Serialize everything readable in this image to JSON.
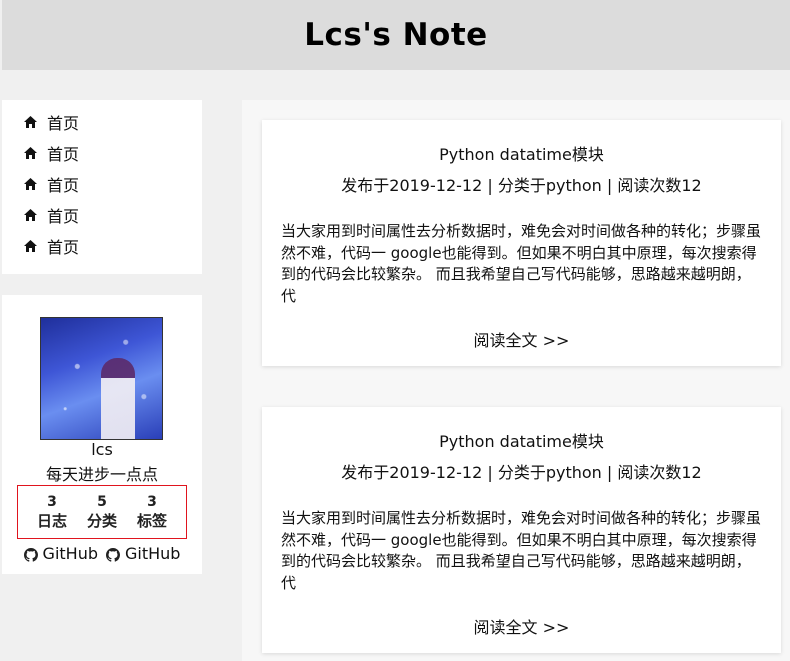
{
  "header": {
    "title": "Lcs's Note"
  },
  "nav": {
    "items": [
      {
        "label": "首页",
        "icon": "home-icon"
      },
      {
        "label": "首页",
        "icon": "home-icon"
      },
      {
        "label": "首页",
        "icon": "home-icon"
      },
      {
        "label": "首页",
        "icon": "home-icon"
      },
      {
        "label": "首页",
        "icon": "home-icon"
      }
    ]
  },
  "profile": {
    "name": "lcs",
    "motto": "每天进步一点点",
    "stats": [
      {
        "count": "3",
        "label": "日志"
      },
      {
        "count": "5",
        "label": "分类"
      },
      {
        "count": "3",
        "label": "标签"
      }
    ],
    "social": [
      {
        "label": "GitHub",
        "icon": "github-icon"
      },
      {
        "label": "GitHub",
        "icon": "github-icon"
      }
    ],
    "stats_border_color": "#e0141e"
  },
  "posts": [
    {
      "title": "Python datatime模块",
      "meta": "发布于2019-12-12 | 分类于python | 阅读次数12",
      "excerpt": "当大家用到时间属性去分析数据时，难免会对时间做各种的转化；步骤虽然不难，代码一 google也能得到。但如果不明白其中原理，每次搜索得到的代码会比较繁杂。 而且我希望自己写代码能够，思路越来越明朗，代",
      "read_more": "阅读全文 >>"
    },
    {
      "title": "Python datatime模块",
      "meta": "发布于2019-12-12 | 分类于python | 阅读次数12",
      "excerpt": "当大家用到时间属性去分析数据时，难免会对时间做各种的转化；步骤虽然不难，代码一 google也能得到。但如果不明白其中原理，每次搜索得到的代码会比较繁杂。 而且我希望自己写代码能够，思路越来越明朗，代",
      "read_more": "阅读全文 >>"
    }
  ]
}
